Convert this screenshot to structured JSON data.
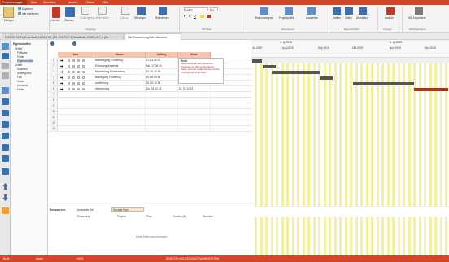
{
  "titlebar": {
    "app_tab": "Projektmanager",
    "menu": [
      "Start",
      "Aktivitäten",
      "Ansicht",
      "Status",
      "Hilfe"
    ]
  },
  "ribbon": {
    "paste": "Einfügen",
    "cut": "Kopieren",
    "format_copy": "Alle markieren",
    "delete": "Löschen",
    "indent": "Gliedern",
    "linking": "Verknüpfung",
    "unlink": "Weiterleiten",
    "layout": "Layout",
    "disruptions": "Störungen",
    "references": "Referenzen",
    "group_outline": "Vorgänge",
    "font_name": "Calibri",
    "font_size": "11",
    "font_bold": "F",
    "font_italic": "K",
    "font_underline": "U",
    "group_font": "Schriftart",
    "resource_pool": "Ressourcenpool",
    "project_profile": "Projektprofile",
    "evaluate": "Auswerten",
    "group_resources": "Ressourcen",
    "numbers": "Zahlen",
    "columns": "Zeilen",
    "activities": "Aktivitäten",
    "group_properties": "Eigenschaften",
    "view": "Ansicht",
    "group_view": "Anzeige",
    "export": "MS-Exportieren",
    "group_export": "MS-Exportieren"
  },
  "tabs": [
    "2019-20170713_Einzelblatt_14426_H17_150 - 2017071 3_Einzelblatt_19.MG_H17_1 (blk",
    "13d Einsatzierung Bob - Aktualisie"
  ],
  "properties": {
    "title": "Eigenschaften",
    "items": [
      "Online",
      "Füllfarbe",
      "Farbe",
      "Eigenschaften",
      "Schrift",
      "Schriftart",
      "Schriftgröße",
      "Fett",
      "Kursiv",
      "Umrandet",
      "Farbe"
    ]
  },
  "grid": {
    "headers": [
      "Info",
      "Name",
      "Anfang",
      "Ende"
    ],
    "rows": [
      {
        "num": "1",
        "name": "Beantragung Förderung",
        "start": "Fr, 14.06.19",
        "end": ""
      },
      {
        "num": "2",
        "name": "Einholung Angebote",
        "start": "Mo, 17.06.19",
        "end": ""
      },
      {
        "num": "3",
        "name": "Bearbeitung Förderantrag",
        "start": "Di, 01.06.19",
        "end": ""
      },
      {
        "num": "4",
        "name": "Bewilligung Förderung",
        "start": "Di, 09.09.19",
        "end": "Di, 19.09.19"
      },
      {
        "num": "5",
        "name": "Ausführung",
        "start": "Di, 01.10.19",
        "end": "Mo, 25.11.19"
      },
      {
        "num": "6",
        "name": "Abrechnung",
        "start": "Do, 01.12.19",
        "end": "Di, 31.12.19"
      },
      {
        "num": "7",
        "name": "",
        "start": "",
        "end": ""
      },
      {
        "num": "8",
        "name": "",
        "start": "",
        "end": ""
      },
      {
        "num": "9",
        "name": "",
        "start": "",
        "end": ""
      },
      {
        "num": "10",
        "name": "",
        "start": "",
        "end": ""
      },
      {
        "num": "11",
        "name": "",
        "start": "",
        "end": ""
      },
      {
        "num": "12",
        "name": "",
        "start": "",
        "end": ""
      },
      {
        "num": "13",
        "name": "",
        "start": "",
        "end": ""
      }
    ]
  },
  "tooltip": {
    "title": "Ende",
    "body": "Zeigt das Ende des geplanten Vorgangs an. Bei verbundenen Zellen wird der Zeitpunkt des letzten Teilvorgangs angezeigt."
  },
  "gantt": {
    "quarters": [
      "3. Q 2019",
      "4. Q 2019"
    ],
    "months": [
      "Jul 2019",
      "Aug 2019",
      "Sep 2019",
      "Okt 2019",
      "Nov 2019",
      "Dez 2019"
    ]
  },
  "bottom": {
    "tab": "Ressourcen",
    "filter_label": "Auswerten für",
    "filter_value": "Genaue Plan",
    "columns": [
      "Ressource",
      "Projekt",
      "Plan",
      "Kosten (€)",
      "Stunden"
    ],
    "empty_message": "Keine Daten zum Anzeigen"
  },
  "statusbar": {
    "left": "NUM",
    "mode": "Admin",
    "zoom": "100%",
    "center": "DESKTOP-MOUCEQJ\\SOFTWARE\\SYSTEM"
  },
  "colors": {
    "brand": "#d24726",
    "header": "#f5c5b0",
    "gantt_stripe": "#f4f0a0",
    "bar": "#555555",
    "bar_critical": "#a8361b"
  }
}
